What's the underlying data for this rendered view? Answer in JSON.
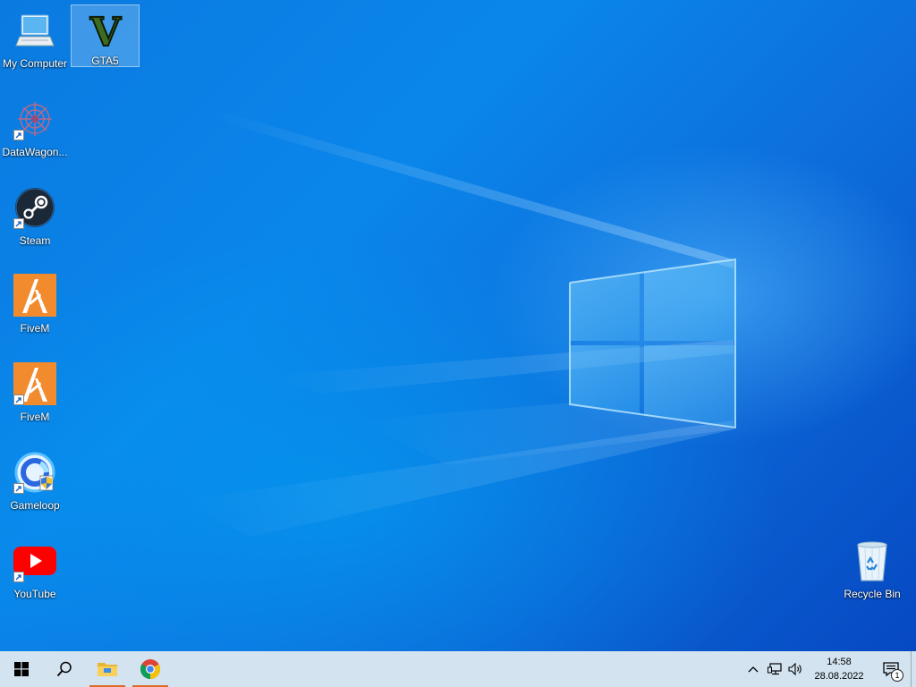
{
  "desktop": {
    "icons": [
      {
        "label": "My Computer",
        "icon": "computer-icon",
        "shortcut": false,
        "selected": false
      },
      {
        "label": "GTA5",
        "icon": "gta5-icon",
        "shortcut": false,
        "selected": true
      },
      {
        "label": "DataWagon...",
        "icon": "datawagon-icon",
        "shortcut": true,
        "selected": false
      },
      {
        "label": "Steam",
        "icon": "steam-icon",
        "shortcut": true,
        "selected": false
      },
      {
        "label": "FiveM",
        "icon": "fivem-icon",
        "shortcut": false,
        "selected": false
      },
      {
        "label": "FiveM",
        "icon": "fivem-icon",
        "shortcut": true,
        "selected": false
      },
      {
        "label": "Gameloop",
        "icon": "gameloop-icon",
        "shortcut": true,
        "selected": false
      },
      {
        "label": "YouTube",
        "icon": "youtube-icon",
        "shortcut": true,
        "selected": false
      },
      {
        "label": "Recycle Bin",
        "icon": "recycle-bin-icon",
        "shortcut": false,
        "selected": false
      }
    ]
  },
  "taskbar": {
    "buttons": [
      {
        "icon": "windows-start-icon"
      },
      {
        "icon": "search-icon"
      },
      {
        "icon": "file-explorer-icon",
        "active": true
      },
      {
        "icon": "chrome-icon",
        "active": true
      }
    ],
    "tray": {
      "icons": [
        "chevron-up-icon",
        "network-icon",
        "volume-icon"
      ],
      "time": "14:58",
      "date": "28.08.2022",
      "notifications_icon": "notifications-icon",
      "notification_count": "1"
    }
  },
  "colors": {
    "taskbar_bg": "#d3e3f0",
    "wallpaper_blue": "#0a7ae0",
    "active_indicator": "#e06a2a"
  }
}
